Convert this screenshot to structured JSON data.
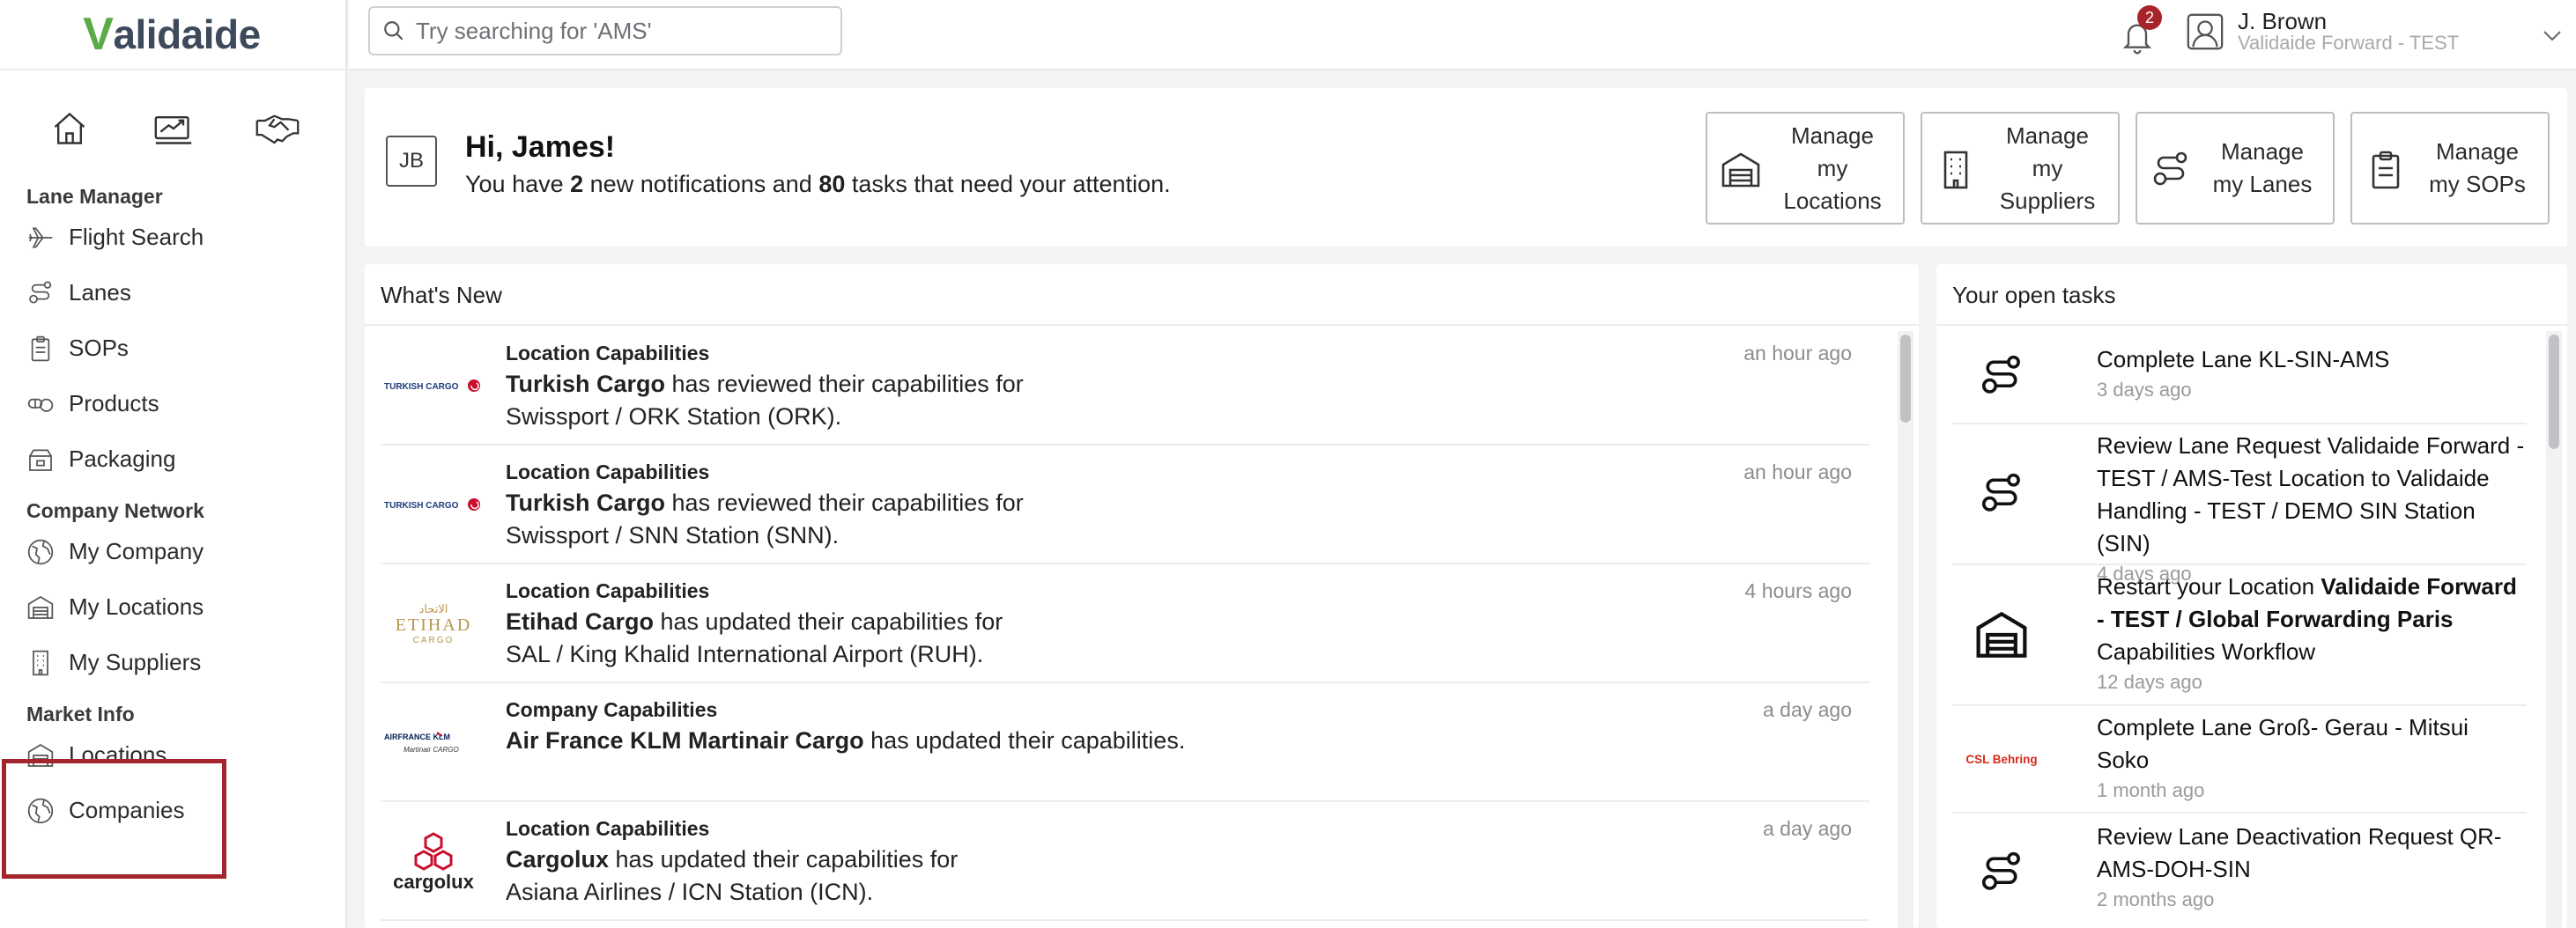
{
  "app": {
    "logo_prefix": "V",
    "logo_rest": "alidaide"
  },
  "sidebar": {
    "quick_icons": [
      "home-icon",
      "chart-icon",
      "handshake-icon"
    ],
    "sections": [
      {
        "title": "Lane Manager",
        "items": [
          "Flight Search",
          "Lanes",
          "SOPs",
          "Products",
          "Packaging"
        ]
      },
      {
        "title": "Company Network",
        "items": [
          "My Company",
          "My Locations",
          "My Suppliers"
        ]
      },
      {
        "title": "Market Info",
        "items": [
          "Locations",
          "Companies"
        ]
      }
    ]
  },
  "header": {
    "search_placeholder": "Try searching for 'AMS'",
    "notification_count": "2",
    "user_name": "J. Brown",
    "user_org": "Validaide Forward - TEST"
  },
  "greeting": {
    "initials": "JB",
    "title": "Hi, James!",
    "text_before": "You have ",
    "notifications": "2",
    "text_middle": " new notifications and ",
    "tasks": "80",
    "text_after": " tasks that need your attention."
  },
  "quick_buttons": [
    {
      "label": "Manage my Locations",
      "icon": "warehouse-icon"
    },
    {
      "label": "Manage my Suppliers",
      "icon": "building-icon"
    },
    {
      "label": "Manage my Lanes",
      "icon": "route-icon"
    },
    {
      "label": "Manage my SOPs",
      "icon": "clipboard-icon"
    }
  ],
  "whats_new": {
    "title": "What's New",
    "items": [
      {
        "type": "Location Capabilities",
        "company": "Turkish Cargo",
        "action": " has reviewed their capabilities for",
        "target": "Swissport / ORK Station (ORK).",
        "time": "an hour ago",
        "logo": "TURKISH CARGO"
      },
      {
        "type": "Location Capabilities",
        "company": "Turkish Cargo",
        "action": " has reviewed their capabilities for",
        "target": "Swissport / SNN Station (SNN).",
        "time": "an hour ago",
        "logo": "TURKISH CARGO"
      },
      {
        "type": "Location Capabilities",
        "company": "Etihad Cargo",
        "action": " has updated their capabilities for",
        "target": "SAL / King Khalid International Airport (RUH).",
        "time": "4 hours ago",
        "logo": "ETIHAD"
      },
      {
        "type": "Company Capabilities",
        "company": "Air France KLM Martinair Cargo",
        "action": " has updated their capabilities.",
        "target": "",
        "time": "a day ago",
        "logo": "AIRFRANCE KLM"
      },
      {
        "type": "Location Capabilities",
        "company": "Cargolux",
        "action": " has updated their capabilities for",
        "target": "Asiana Airlines / ICN Station (ICN).",
        "time": "a day ago",
        "logo": "cargolux"
      }
    ]
  },
  "open_tasks": {
    "title": "Your open tasks",
    "items": [
      {
        "text": "Complete Lane KL-SIN-AMS",
        "bold": "",
        "text_after": "",
        "time": "3 days ago",
        "icon": "route-icon"
      },
      {
        "text": "Review Lane Request Validaide Forward - TEST / AMS-Test Location to Validaide Handling - TEST / DEMO SIN Station (SIN)",
        "bold": "",
        "text_after": "",
        "time": "4 days ago",
        "icon": "route-icon"
      },
      {
        "text": "Restart your Location ",
        "bold": "Validaide Forward - TEST / Global Forwarding Paris",
        "text_after": " Capabilities Workflow",
        "time": "12 days ago",
        "icon": "warehouse-icon"
      },
      {
        "text": "Complete Lane Groß- Gerau - Mitsui Soko",
        "bold": "",
        "text_after": "",
        "time": "1 month ago",
        "icon": "CSL Behring"
      },
      {
        "text": "Review Lane Deactivation Request QR-AMS-DOH-SIN",
        "bold": "",
        "text_after": "",
        "time": "2 months ago",
        "icon": "route-icon"
      }
    ]
  },
  "colors": {
    "brand_green": "#5aaa46",
    "badge_red": "#a8232a",
    "highlight_red": "#a4262c"
  }
}
